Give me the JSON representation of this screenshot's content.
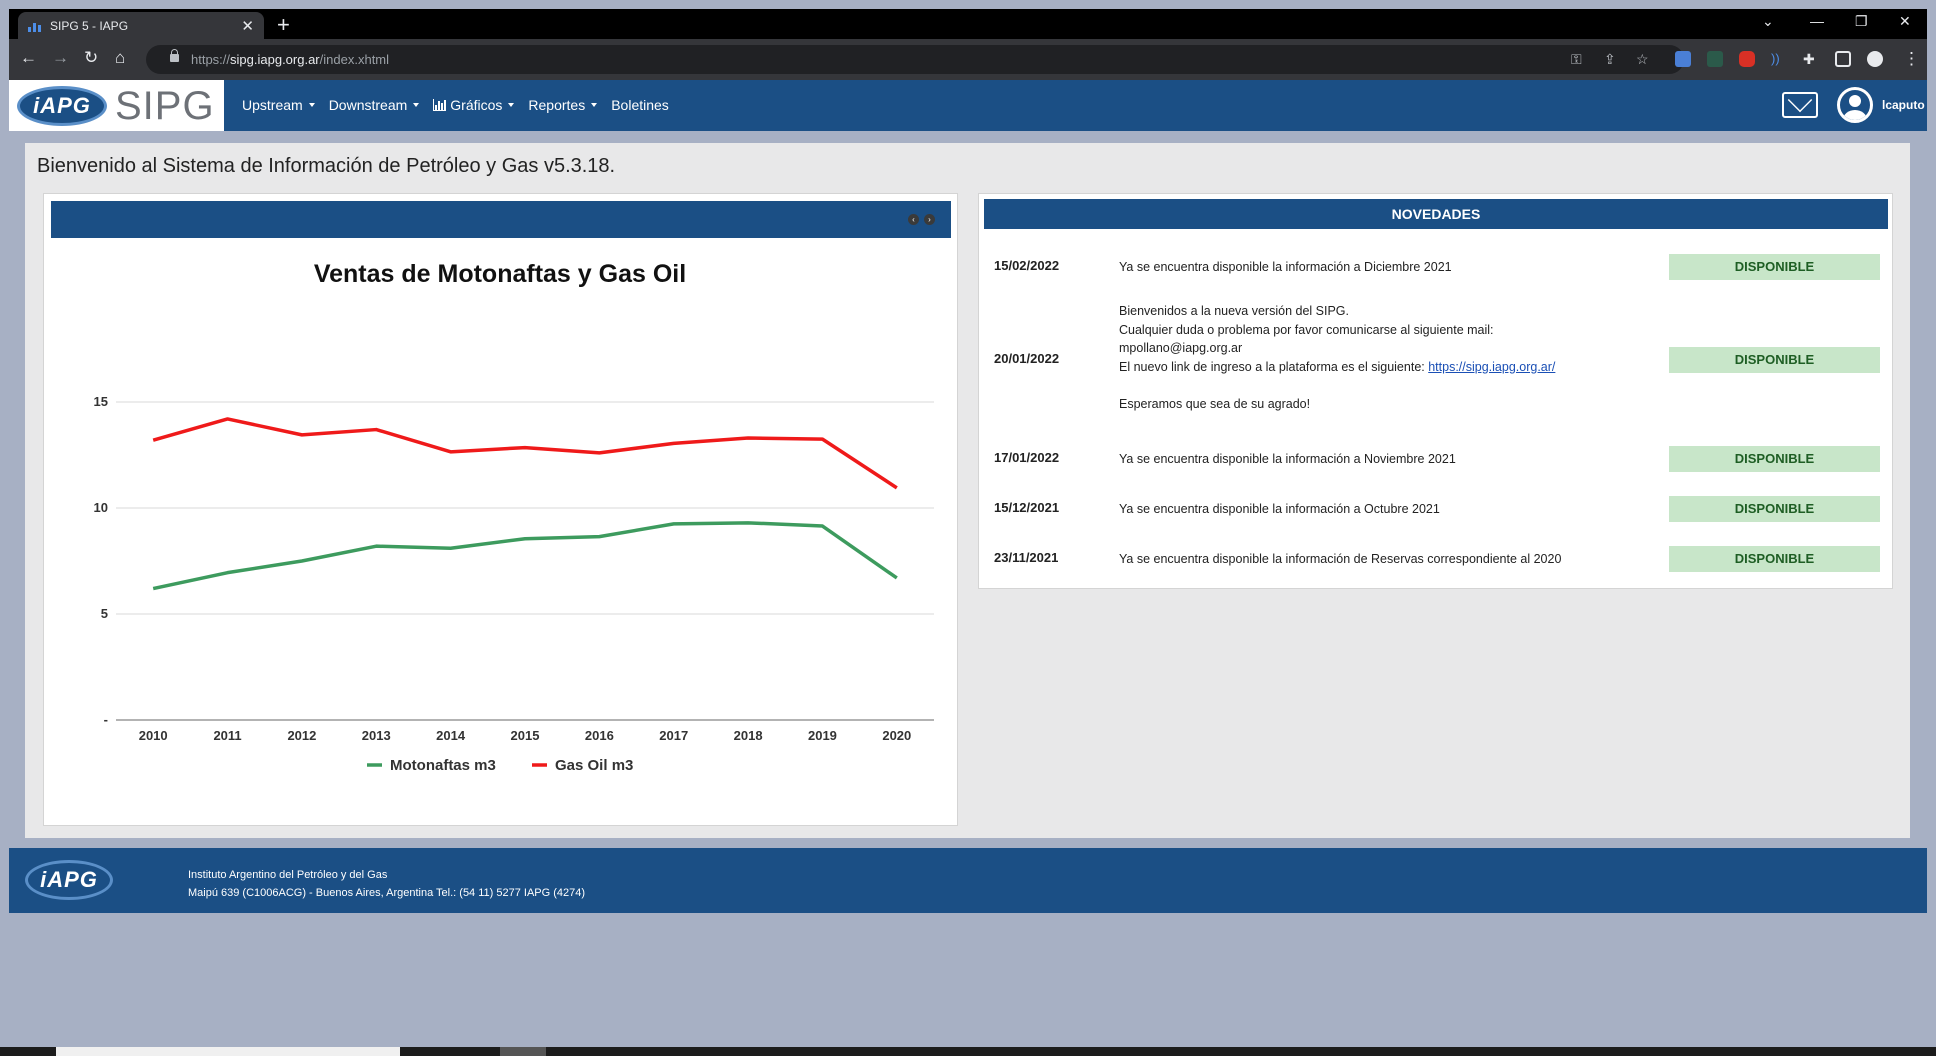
{
  "browser": {
    "tab_title": "SIPG 5 - IAPG",
    "url_scheme": "https://",
    "url_host": "sipg.iapg.org.ar",
    "url_path": "/index.xhtml"
  },
  "header": {
    "logo_text": "iAPG",
    "brand": "SIPG",
    "menu": [
      "Upstream",
      "Downstream",
      "Gráficos",
      "Reportes",
      "Boletines"
    ],
    "username": "lcaputo"
  },
  "main": {
    "welcome": "Bienvenido al Sistema de Información de Petróleo y Gas v5.3.18."
  },
  "news": {
    "title": "NOVEDADES",
    "items": [
      {
        "date": "15/02/2022",
        "text": "Ya se encuentra disponible la información a Diciembre 2021",
        "status": "DISPONIBLE"
      },
      {
        "date": "20/01/2022",
        "line1": "Bienvenidos a la nueva versión del SIPG.",
        "line2": "Cualquier duda o problema por favor comunicarse al siguiente mail:",
        "line3": "mpollano@iapg.org.ar",
        "line4": "El nuevo link de ingreso a la plataforma es el siguiente: ",
        "link": "https://sipg.iapg.org.ar/",
        "line6": "Esperamos que sea de su agrado!",
        "status": "DISPONIBLE"
      },
      {
        "date": "17/01/2022",
        "text": "Ya se encuentra disponible la información a Noviembre 2021",
        "status": "DISPONIBLE"
      },
      {
        "date": "15/12/2021",
        "text": "Ya se encuentra disponible la información a Octubre 2021",
        "status": "DISPONIBLE"
      },
      {
        "date": "23/11/2021",
        "text": "Ya se encuentra disponible la información de Reservas correspondiente al 2020",
        "status": "DISPONIBLE"
      }
    ]
  },
  "footer": {
    "logo_text": "iAPG",
    "line1": "Instituto Argentino del Petróleo y del Gas",
    "line2": "Maipú 639 (C1006ACG) - Buenos Aires, Argentina Tel.: (54 11) 5277 IAPG (4274)"
  },
  "chart_data": {
    "type": "line",
    "title": "Ventas de Motonaftas y Gas Oil",
    "xlabel": "",
    "ylabel": "",
    "x": [
      "2010",
      "2011",
      "2012",
      "2013",
      "2014",
      "2015",
      "2016",
      "2017",
      "2018",
      "2019",
      "2020"
    ],
    "ylim": [
      0,
      15
    ],
    "yticks": [
      "-",
      "5",
      "10",
      "15"
    ],
    "grid": true,
    "legend_position": "bottom",
    "series": [
      {
        "name": "Motonaftas m3",
        "color": "#3d9b5e",
        "values": [
          6.2,
          6.95,
          7.5,
          8.2,
          8.1,
          8.55,
          8.65,
          9.25,
          9.3,
          9.15,
          6.7
        ]
      },
      {
        "name": "Gas Oil m3",
        "color": "#ef1a1a",
        "values": [
          13.2,
          14.2,
          13.45,
          13.7,
          12.65,
          12.85,
          12.6,
          13.05,
          13.3,
          13.25,
          10.95
        ]
      }
    ]
  }
}
